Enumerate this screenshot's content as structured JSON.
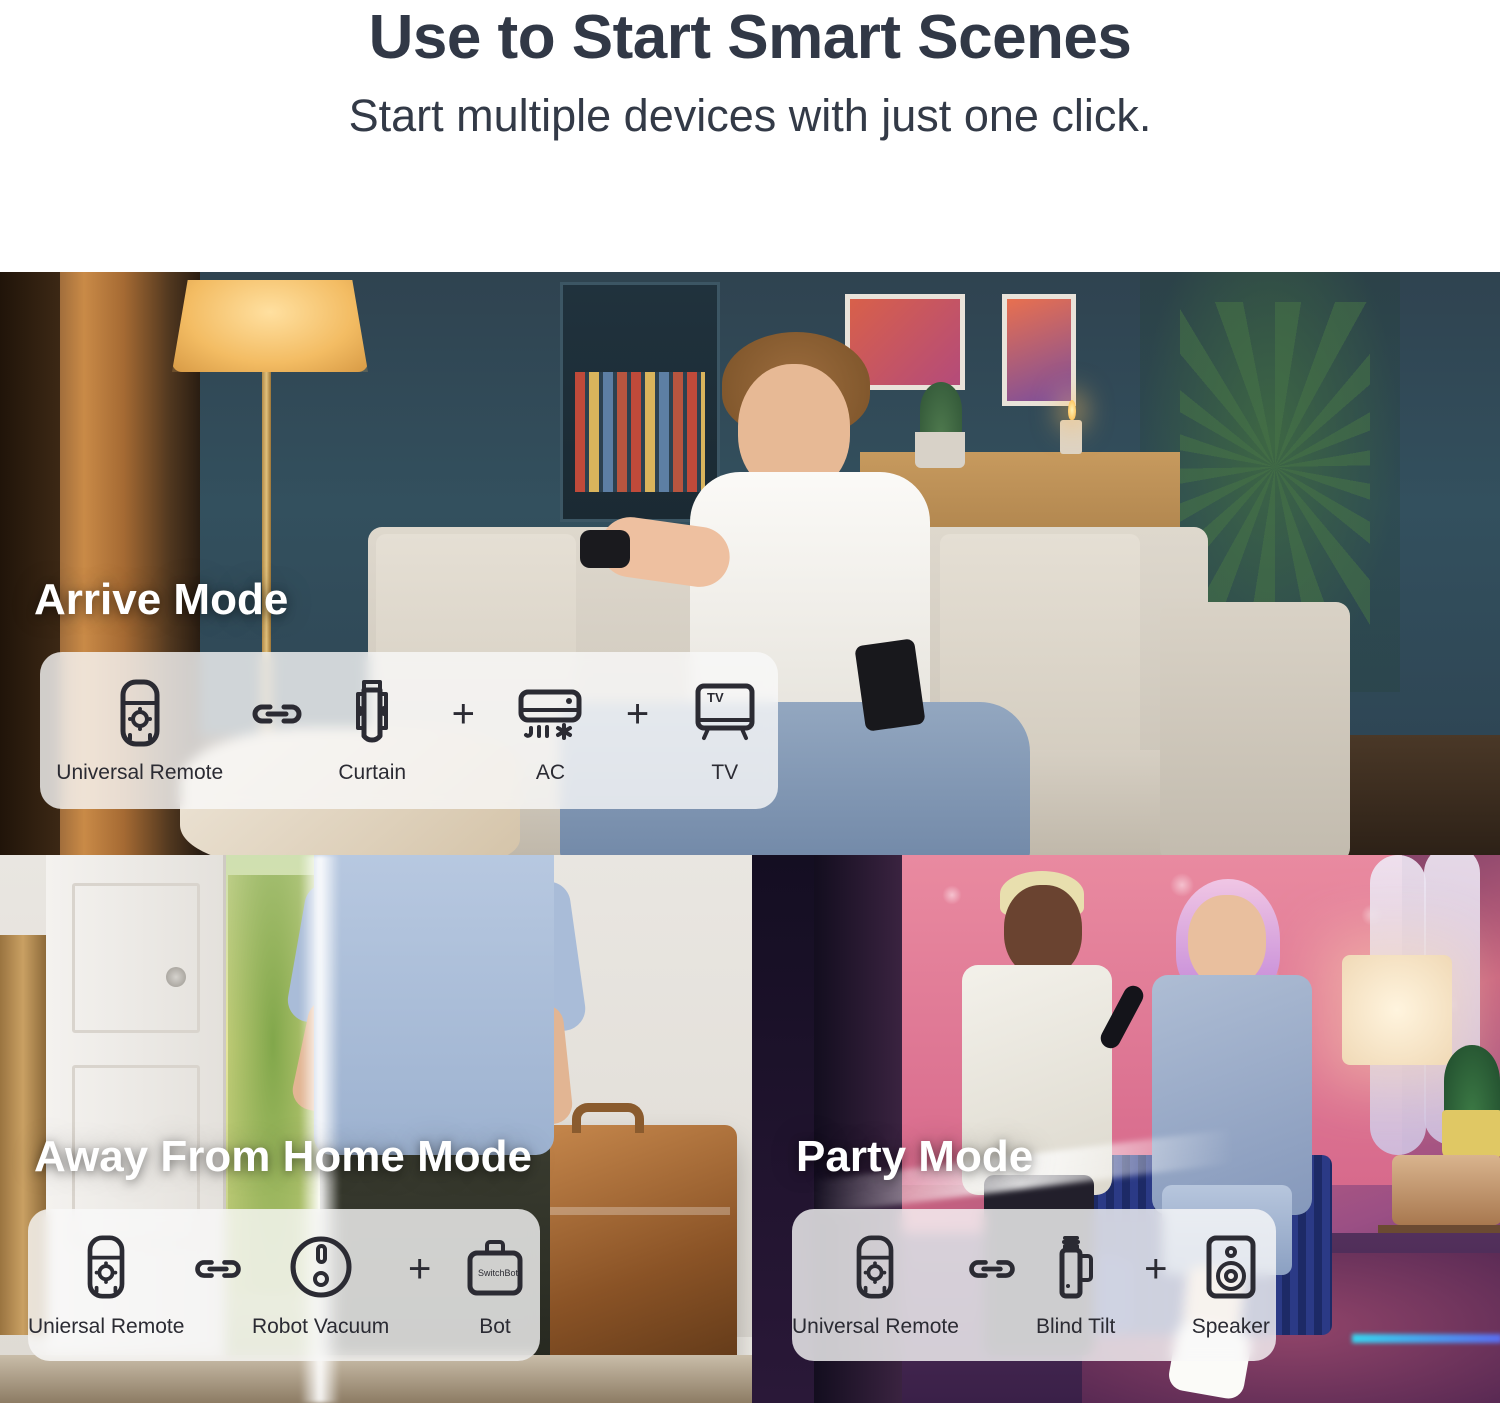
{
  "header": {
    "title": "Use to Start Smart Scenes",
    "subtitle": "Start multiple devices with just one click."
  },
  "colors": {
    "title_text": "#313846",
    "mode_title_text": "#ffffff",
    "card_background": "rgba(249,249,249,0.80)",
    "icon_stroke": "#2b2b33",
    "device_label_text": "#2b2b33"
  },
  "separators": {
    "link": "link-icon",
    "plus": "+"
  },
  "scenes": [
    {
      "key": "arrive",
      "mode_title": "Arrive Mode",
      "scene_description": "teen sitting on sofa in teal living room pointing a remote",
      "devices": [
        {
          "label": "Universal Remote",
          "icon": "universal-remote-icon"
        },
        {
          "label": "Curtain",
          "icon": "curtain-icon"
        },
        {
          "label": "AC",
          "icon": "ac-icon"
        },
        {
          "label": "TV",
          "icon": "tv-icon",
          "screen_text": "TV"
        }
      ],
      "separators": [
        "link",
        "plus",
        "plus"
      ]
    },
    {
      "key": "away",
      "mode_title": "Away From Home Mode",
      "scene_description": "man in blue shirt opening a white door carrying a brown suitcase",
      "devices": [
        {
          "label": "Uniersal Remote",
          "icon": "universal-remote-icon"
        },
        {
          "label": "Robot Vacuum",
          "icon": "robot-vacuum-icon"
        },
        {
          "label": "Bot",
          "icon": "bot-icon",
          "brand_text": "SwitchBot"
        }
      ],
      "separators": [
        "link",
        "plus"
      ]
    },
    {
      "key": "party",
      "mode_title": "Party Mode",
      "scene_description": "two people singing karaoke under pink and purple party lighting",
      "devices": [
        {
          "label": "Universal Remote",
          "icon": "universal-remote-icon"
        },
        {
          "label": "Blind Tilt",
          "icon": "blind-tilt-icon"
        },
        {
          "label": "Speaker",
          "icon": "speaker-icon"
        }
      ],
      "separators": [
        "link",
        "plus"
      ]
    }
  ]
}
